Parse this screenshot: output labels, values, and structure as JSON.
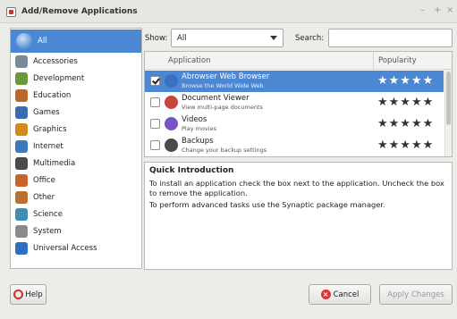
{
  "window": {
    "title": "Add/Remove Applications",
    "controls": [
      "–",
      "+",
      "×"
    ]
  },
  "categories": [
    {
      "label": "All",
      "icon": "all-icon",
      "color": "#5b8fd6",
      "selected": true
    },
    {
      "label": "Accessories",
      "icon": "accessories-icon",
      "color": "#7a8a9a"
    },
    {
      "label": "Development",
      "icon": "development-icon",
      "color": "#6a9a3a"
    },
    {
      "label": "Education",
      "icon": "education-icon",
      "color": "#b8692b"
    },
    {
      "label": "Games",
      "icon": "games-icon",
      "color": "#3c6bb0"
    },
    {
      "label": "Graphics",
      "icon": "graphics-icon",
      "color": "#d08a1c"
    },
    {
      "label": "Internet",
      "icon": "internet-icon",
      "color": "#3b7bbd"
    },
    {
      "label": "Multimedia",
      "icon": "multimedia-icon",
      "color": "#4a4a4a"
    },
    {
      "label": "Office",
      "icon": "office-icon",
      "color": "#c8642a"
    },
    {
      "label": "Other",
      "icon": "other-icon",
      "color": "#b87030"
    },
    {
      "label": "Science",
      "icon": "science-icon",
      "color": "#3f8fb0"
    },
    {
      "label": "System",
      "icon": "system-icon",
      "color": "#8a8a8a"
    },
    {
      "label": "Universal Access",
      "icon": "universal-access-icon",
      "color": "#2f6fc2"
    }
  ],
  "filter": {
    "show_label": "Show:",
    "show_value": "All",
    "search_label": "Search:",
    "search_value": ""
  },
  "apps_table": {
    "columns": [
      "Application",
      "Popularity"
    ],
    "rows": [
      {
        "name": "Abrowser Web Browser",
        "desc": "Browse the World Wide Web",
        "checked": true,
        "selected": true,
        "stars": "★★★★★",
        "icon_color": "#3a6fc4"
      },
      {
        "name": "Document Viewer",
        "desc": "View multi-page documents",
        "checked": false,
        "selected": false,
        "stars": "★★★★★",
        "icon_color": "#c9453a"
      },
      {
        "name": "Videos",
        "desc": "Play movies",
        "checked": false,
        "selected": false,
        "stars": "★★★★★",
        "icon_color": "#7a52c7"
      },
      {
        "name": "Backups",
        "desc": "Change your backup settings",
        "checked": false,
        "selected": false,
        "stars": "★★★★★",
        "icon_color": "#4a4a4a"
      }
    ]
  },
  "intro": {
    "heading": "Quick Introduction",
    "p1": "To install an application check the box next to the application. Uncheck the box to remove the application.",
    "p2": "To perform advanced tasks use the Synaptic package manager."
  },
  "buttons": {
    "help": "Help",
    "cancel": "Cancel",
    "apply": "Apply Changes"
  }
}
